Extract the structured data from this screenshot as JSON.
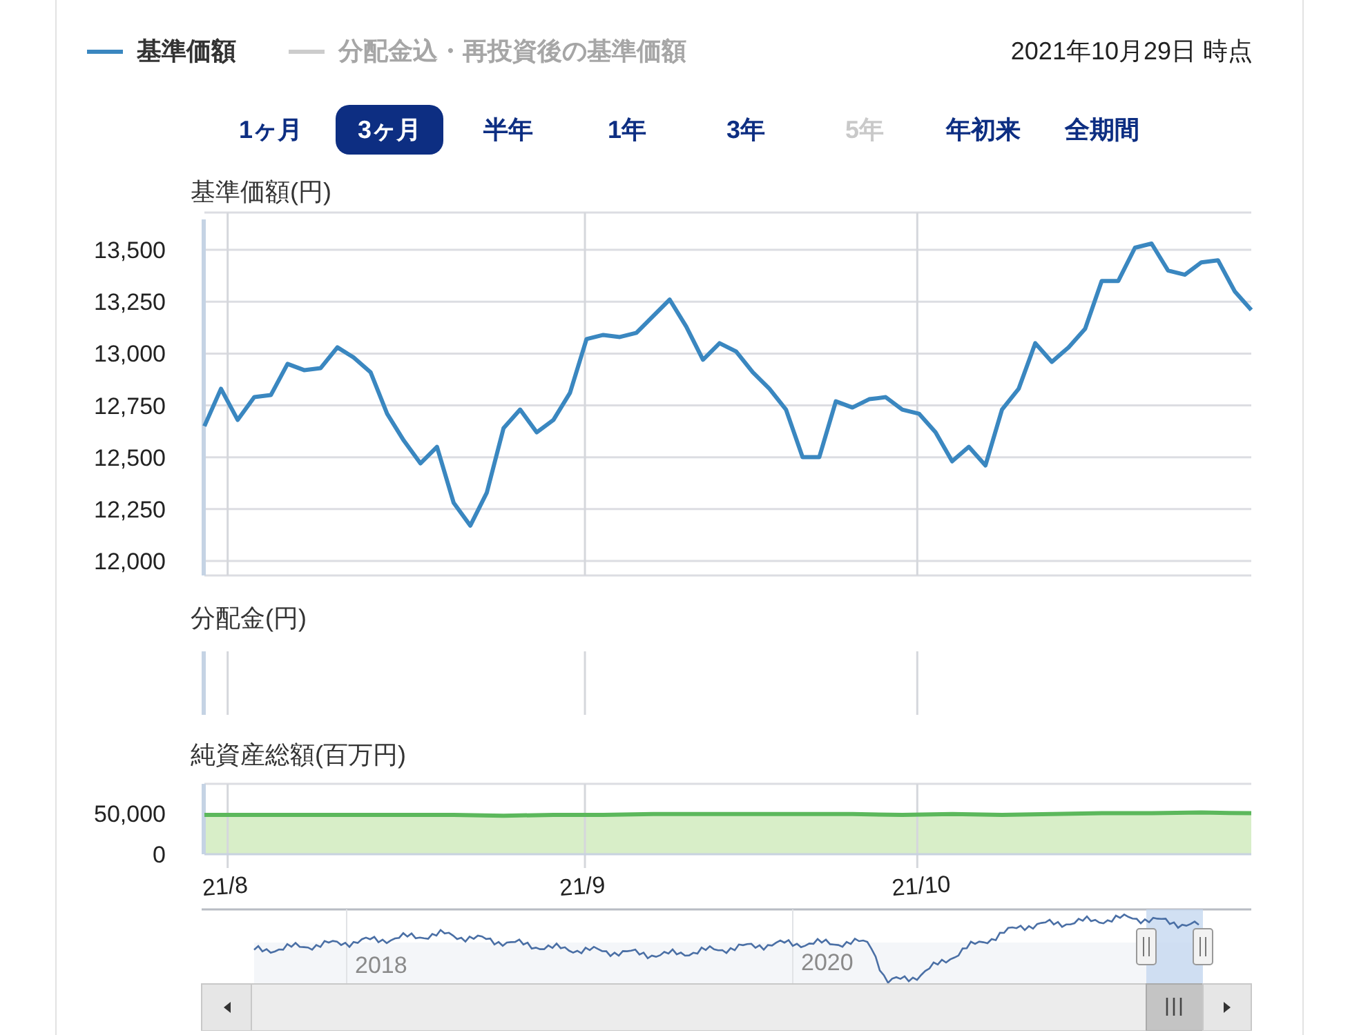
{
  "legend": [
    {
      "label": "基準価額",
      "color": "#3a87c0",
      "enabled": true
    },
    {
      "label": "分配金込・再投資後の基準価額",
      "color": "#cccccc",
      "enabled": false
    }
  ],
  "as_of": "2021年10月29日 時点",
  "ranges": [
    {
      "label": "1ヶ月",
      "selected": false,
      "disabled": false
    },
    {
      "label": "3ヶ月",
      "selected": true,
      "disabled": false
    },
    {
      "label": "半年",
      "selected": false,
      "disabled": false
    },
    {
      "label": "1年",
      "selected": false,
      "disabled": false
    },
    {
      "label": "3年",
      "selected": false,
      "disabled": false
    },
    {
      "label": "5年",
      "selected": false,
      "disabled": true
    },
    {
      "label": "年初来",
      "selected": false,
      "disabled": false
    },
    {
      "label": "全期間",
      "selected": false,
      "disabled": false
    }
  ],
  "price_chart": {
    "title": "基準価額(円)",
    "chart_data": {
      "type": "line",
      "grid": true,
      "ylim": [
        11930,
        13680
      ],
      "yticks": [
        {
          "value": 12000,
          "label": "12,000"
        },
        {
          "value": 12250,
          "label": "12,250"
        },
        {
          "value": 12500,
          "label": "12,500"
        },
        {
          "value": 12750,
          "label": "12,750"
        },
        {
          "value": 13000,
          "label": "13,000"
        },
        {
          "value": 13250,
          "label": "13,250"
        },
        {
          "value": 13500,
          "label": "13,500"
        }
      ],
      "series": [
        {
          "color": "#3a87c0",
          "values": [
            12650,
            12830,
            12680,
            12790,
            12800,
            12950,
            12920,
            12930,
            13030,
            12980,
            12910,
            12710,
            12580,
            12470,
            12550,
            12280,
            12170,
            12330,
            12640,
            12730,
            12620,
            12680,
            12810,
            13070,
            13090,
            13080,
            13100,
            13180,
            13260,
            13130,
            12970,
            13050,
            13010,
            12910,
            12830,
            12730,
            12500,
            12500,
            12770,
            12740,
            12780,
            12790,
            12730,
            12710,
            12620,
            12480,
            12550,
            12460,
            12730,
            12830,
            13050,
            12960,
            13030,
            13120,
            13350,
            13350,
            13510,
            13530,
            13400,
            13380,
            13440,
            13450,
            13300,
            13210
          ]
        }
      ]
    }
  },
  "distribution_chart": {
    "title": "分配金(円)"
  },
  "assets_chart": {
    "title": "純資産総額(百万円)",
    "chart_data": {
      "type": "area",
      "ylim": [
        0,
        86000
      ],
      "yticks": [
        {
          "value": 0,
          "label": "0"
        },
        {
          "value": 50000,
          "label": "50,000"
        }
      ],
      "series": [
        {
          "color": "#5cb85c",
          "values": [
            48000,
            48000,
            48000,
            48000,
            48000,
            48000,
            47000,
            48000,
            48000,
            49000,
            49000,
            49000,
            49000,
            49000,
            48000,
            49000,
            48000,
            49000,
            50000,
            50000,
            51000,
            50000
          ]
        }
      ]
    },
    "date_labels": [
      "21/8",
      "21/9",
      "21/10"
    ]
  },
  "navigator": {
    "years": [
      "2018",
      "2020"
    ]
  }
}
